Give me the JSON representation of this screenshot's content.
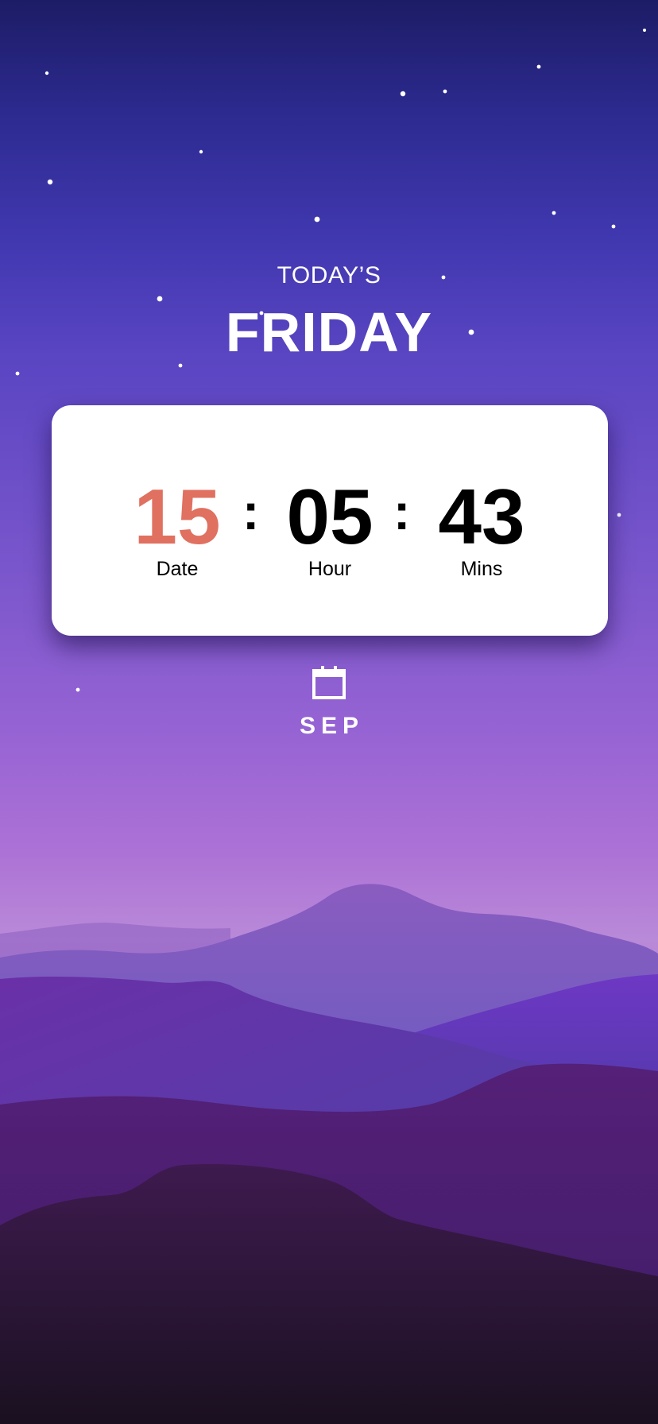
{
  "header": {
    "subtitle": "TODAY’S",
    "day": "FRIDAY"
  },
  "clock": {
    "date": {
      "value": "15",
      "label": "Date"
    },
    "hour": {
      "value": "05",
      "label": "Hour"
    },
    "mins": {
      "value": "43",
      "label": "Mins"
    },
    "separator": ":"
  },
  "month": {
    "icon": "calendar-icon",
    "label": "SEP"
  },
  "colors": {
    "date_accent": "#e07060",
    "card_background": "#ffffff",
    "text_light": "#ffffff"
  }
}
